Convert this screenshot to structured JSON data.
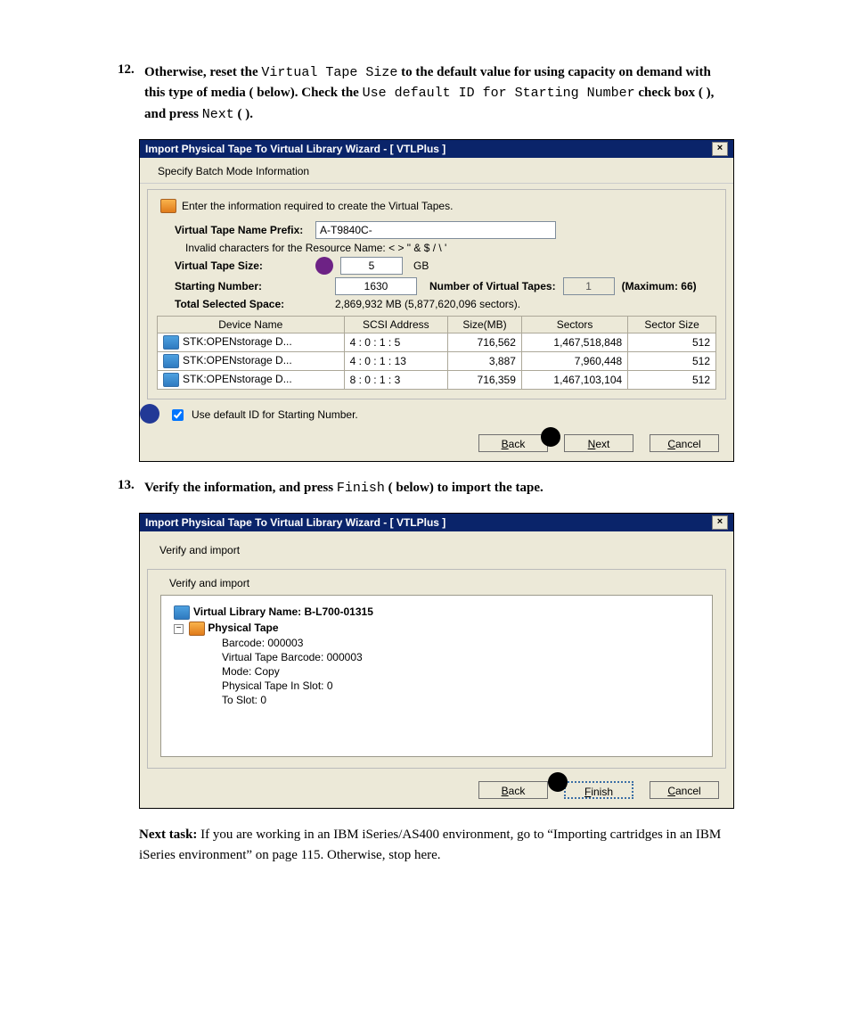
{
  "steps": {
    "s12": {
      "num": "12.",
      "pre1": "Otherwise, reset the ",
      "mono1": "Virtual Tape Size",
      "pre2": " to the default value for using capacity on demand with this type of media (   below). Check the ",
      "mono2": "Use default ID for Starting Number",
      "pre3": " check box (  ), and press ",
      "mono3": "Next",
      "pre4": " (  )."
    },
    "s13": {
      "num": "13.",
      "pre1": "Verify the information, and press ",
      "mono1": "Finish",
      "pre2": " (    below) to import the tape."
    }
  },
  "dialog1": {
    "title": "Import Physical Tape To Virtual Library Wizard - [ VTLPlus ]",
    "subtitle": "Specify Batch Mode Information",
    "intro": "Enter the information required to create the Virtual Tapes.",
    "labels": {
      "prefix": "Virtual Tape Name Prefix:",
      "invalid": "Invalid characters for the Resource Name: < > \" & $ / \\ '",
      "size": "Virtual Tape Size:",
      "gb": "GB",
      "start": "Starting Number:",
      "numvt": "Number of Virtual Tapes:",
      "max": "(Maximum: 66)",
      "space": "Total Selected Space:",
      "spaceval": "2,869,932 MB (5,877,620,096 sectors)."
    },
    "values": {
      "prefix": "A-T9840C-",
      "size": "5",
      "start": "1630",
      "numvt": "1"
    },
    "columns": [
      "Device Name",
      "SCSI Address",
      "Size(MB)",
      "Sectors",
      "Sector Size"
    ],
    "rows": [
      {
        "dev": "STK:OPENstorage D...",
        "scsi": "4 : 0 : 1 : 5",
        "size": "716,562",
        "sectors": "1,467,518,848",
        "sec": "512"
      },
      {
        "dev": "STK:OPENstorage D...",
        "scsi": "4 : 0 : 1 : 13",
        "size": "3,887",
        "sectors": "7,960,448",
        "sec": "512"
      },
      {
        "dev": "STK:OPENstorage D...",
        "scsi": "8 : 0 : 1 : 3",
        "size": "716,359",
        "sectors": "1,467,103,104",
        "sec": "512"
      }
    ],
    "checkbox": "Use default ID for Starting Number.",
    "buttons": {
      "back": "Back",
      "next": "Next",
      "cancel": "Cancel"
    }
  },
  "dialog2": {
    "title": "Import Physical Tape To Virtual Library Wizard - [ VTLPlus ]",
    "header": "Verify and import",
    "innerHeader": "Verify and import",
    "tree": {
      "vl": "Virtual Library Name: B-L700-01315",
      "pt": "Physical Tape",
      "items": [
        "Barcode: 000003",
        "Virtual Tape Barcode: 000003",
        "Mode: Copy",
        "Physical Tape In Slot: 0",
        "To Slot: 0"
      ]
    },
    "buttons": {
      "back": "Back",
      "finish": "Finish",
      "cancel": "Cancel"
    }
  },
  "nexttask": {
    "label": "Next task:",
    "text": "  If you are working in an IBM iSeries/AS400 environment, go to “Importing cartridges in an IBM iSeries environment” on page 115. Otherwise, stop here."
  },
  "callouts": {
    "purple_near_size": "size-callout",
    "blue_near_checkbox": "checkbox-callout",
    "black_near_next": "next-callout",
    "black_near_finish": "finish-callout"
  }
}
